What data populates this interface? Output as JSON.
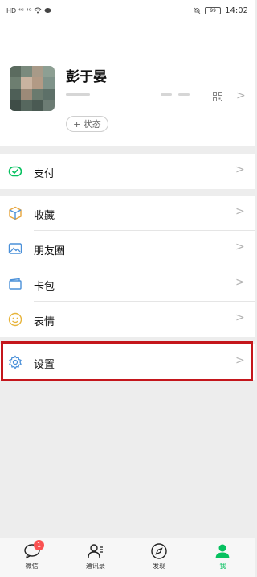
{
  "status_bar": {
    "left_text": "HD ⁴ᴳ ⁴ᴳ",
    "battery": "99",
    "time": "14:02"
  },
  "profile": {
    "nickname": "彭于晏",
    "status_button": "+ 状态",
    "chevron": ">"
  },
  "menu": {
    "pay": "支付",
    "favorites": "收藏",
    "moments": "朋友圈",
    "cards": "卡包",
    "stickers": "表情",
    "settings": "设置",
    "chevron": ">"
  },
  "tabbar": {
    "chats": "微信",
    "chats_badge": "1",
    "contacts": "通讯录",
    "discover": "发现",
    "me": "我"
  },
  "colors": {
    "accent": "#07c160",
    "badge": "#fa5151",
    "highlight_box": "#c4161c"
  },
  "icons": [
    "pay-icon",
    "favorites-icon",
    "moments-icon",
    "cards-icon",
    "stickers-icon",
    "settings-icon",
    "chats-icon",
    "contacts-icon",
    "discover-icon",
    "me-icon",
    "qr-code-icon"
  ]
}
